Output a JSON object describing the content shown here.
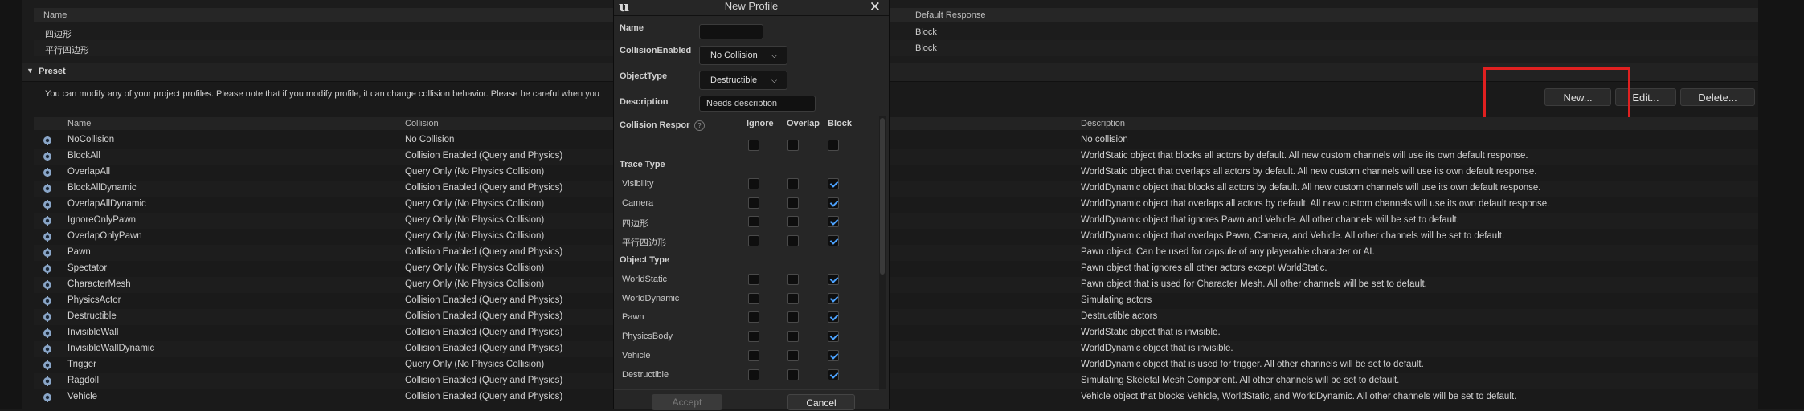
{
  "top_table": {
    "header": {
      "name": "Name",
      "default_response": "Default Response"
    },
    "rows": [
      {
        "name": "四边形",
        "response": "Block"
      },
      {
        "name": "平行四边形",
        "response": "Block"
      }
    ]
  },
  "preset": {
    "title": "Preset",
    "notice": "You can modify any of your project profiles. Please note that if you modify profile, it can change collision behavior. Please be careful when you",
    "buttons": {
      "new": "New...",
      "edit": "Edit...",
      "delete": "Delete..."
    },
    "columns": {
      "name": "Name",
      "collision": "Collision",
      "description": "Description"
    },
    "rows": [
      {
        "name": "NoCollision",
        "collision": "No Collision",
        "description": "No collision"
      },
      {
        "name": "BlockAll",
        "collision": "Collision Enabled (Query and Physics)",
        "description": "WorldStatic object that blocks all actors by default. All new custom channels will use its own default response."
      },
      {
        "name": "OverlapAll",
        "collision": "Query Only (No Physics Collision)",
        "description": "WorldStatic object that overlaps all actors by default. All new custom channels will use its own default response."
      },
      {
        "name": "BlockAllDynamic",
        "collision": "Collision Enabled (Query and Physics)",
        "description": "WorldDynamic object that blocks all actors by default. All new custom channels will use its own default response."
      },
      {
        "name": "OverlapAllDynamic",
        "collision": "Query Only (No Physics Collision)",
        "description": "WorldDynamic object that overlaps all actors by default. All new custom channels will use its own default response."
      },
      {
        "name": "IgnoreOnlyPawn",
        "collision": "Query Only (No Physics Collision)",
        "description": "WorldDynamic object that ignores Pawn and Vehicle. All other channels will be set to default."
      },
      {
        "name": "OverlapOnlyPawn",
        "collision": "Query Only (No Physics Collision)",
        "description": "WorldDynamic object that overlaps Pawn, Camera, and Vehicle. All other channels will be set to default."
      },
      {
        "name": "Pawn",
        "collision": "Collision Enabled (Query and Physics)",
        "description": "Pawn object. Can be used for capsule of any playerable character or AI."
      },
      {
        "name": "Spectator",
        "collision": "Query Only (No Physics Collision)",
        "description": "Pawn object that ignores all other actors except WorldStatic."
      },
      {
        "name": "CharacterMesh",
        "collision": "Query Only (No Physics Collision)",
        "description": "Pawn object that is used for Character Mesh. All other channels will be set to default."
      },
      {
        "name": "PhysicsActor",
        "collision": "Collision Enabled (Query and Physics)",
        "description": "Simulating actors"
      },
      {
        "name": "Destructible",
        "collision": "Collision Enabled (Query and Physics)",
        "description": "Destructible actors"
      },
      {
        "name": "InvisibleWall",
        "collision": "Collision Enabled (Query and Physics)",
        "description": "WorldStatic object that is invisible."
      },
      {
        "name": "InvisibleWallDynamic",
        "collision": "Collision Enabled (Query and Physics)",
        "description": "WorldDynamic object that is invisible."
      },
      {
        "name": "Trigger",
        "collision": "Query Only (No Physics Collision)",
        "description": "WorldDynamic object that is used for trigger. All other channels will be set to default."
      },
      {
        "name": "Ragdoll",
        "collision": "Collision Enabled (Query and Physics)",
        "description": "Simulating Skeletal Mesh Component. All other channels will be set to default."
      },
      {
        "name": "Vehicle",
        "collision": "Collision Enabled (Query and Physics)",
        "description": "Vehicle object that blocks Vehicle, WorldStatic, and WorldDynamic. All other channels will be set to default."
      }
    ]
  },
  "dialog": {
    "logo": "u",
    "title": "New Profile",
    "name_label": "Name",
    "name_value": "",
    "collision_enabled_label": "CollisionEnabled",
    "collision_enabled_value": "No Collision",
    "object_type_label": "ObjectType",
    "object_type_value": "Destructible",
    "description_label": "Description",
    "description_value": "Needs description",
    "collision_responses_label": "Collision Respor",
    "col_ignore": "Ignore",
    "col_overlap": "Overlap",
    "col_block": "Block",
    "trace_type_label": "Trace Type",
    "object_type_section_label": "Object Type",
    "trace_channels": [
      {
        "name": "Visibility",
        "response": "block"
      },
      {
        "name": "Camera",
        "response": "block"
      },
      {
        "name": "四边形",
        "response": "block"
      },
      {
        "name": "平行四边形",
        "response": "block"
      }
    ],
    "object_channels": [
      {
        "name": "WorldStatic",
        "response": "block"
      },
      {
        "name": "WorldDynamic",
        "response": "block"
      },
      {
        "name": "Pawn",
        "response": "block"
      },
      {
        "name": "PhysicsBody",
        "response": "block"
      },
      {
        "name": "Vehicle",
        "response": "block"
      },
      {
        "name": "Destructible",
        "response": "block"
      }
    ],
    "accept_label": "Accept",
    "cancel_label": "Cancel"
  }
}
